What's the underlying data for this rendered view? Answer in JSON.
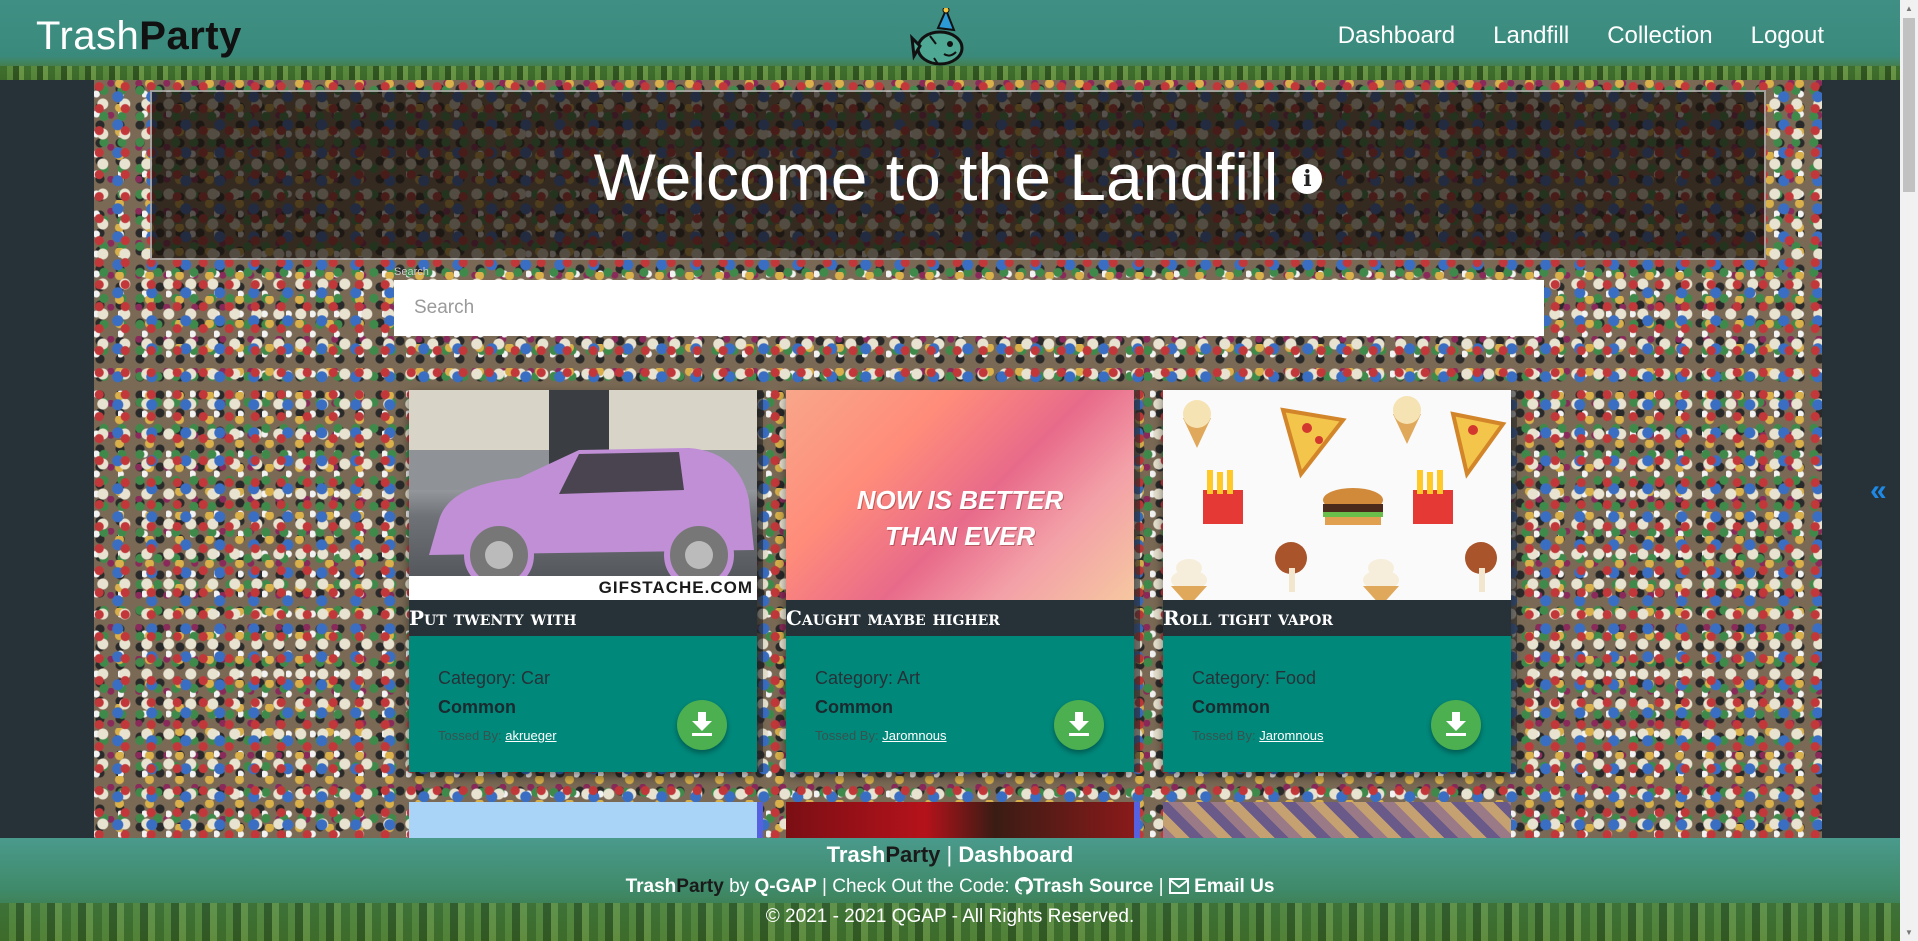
{
  "navbar": {
    "brand_part1": "Trash",
    "brand_part2": "Party",
    "links": [
      "Dashboard",
      "Landfill",
      "Collection",
      "Logout"
    ]
  },
  "banner": {
    "title": "Welcome to the Landfill"
  },
  "search": {
    "label": "Search",
    "placeholder": "Search"
  },
  "cards": [
    {
      "title": "Put twenty with",
      "category": "Category: Car",
      "rarity": "Common",
      "tossed_by_label": "Tossed By:",
      "tossed_by_user": "akrueger",
      "watermark": "GIFSTACHE.COM"
    },
    {
      "title": "Caught maybe higher",
      "category": "Category: Art",
      "rarity": "Common",
      "tossed_by_label": "Tossed By:",
      "tossed_by_user": "Jaromnous",
      "quote_line1": "NOW IS BETTER",
      "quote_line2": "THAN EVER"
    },
    {
      "title": "Roll tight vapor",
      "category": "Category: Food",
      "rarity": "Common",
      "tossed_by_label": "Tossed By:",
      "tossed_by_user": "Jaromnous"
    }
  ],
  "footer": {
    "line1_brand1": "Trash",
    "line1_brand2": "Party",
    "line1_sep": "|",
    "line1_link": "Dashboard",
    "line2_brand1": "Trash",
    "line2_brand2": "Party",
    "line2_by": "by",
    "line2_team": "Q-GAP",
    "line2_text": "| Check Out the Code:",
    "line2_source": "Trash Source",
    "line2_sep": "|",
    "line2_email": "Email Us",
    "copyright": "© 2021 - 2021 QGAP - All Rights Reserved."
  },
  "colors": {
    "navbar": "#3f8f85",
    "card_body": "#00897b",
    "card_title_bg": "#263238",
    "download_button": "#4caf50",
    "page_bg": "#263238"
  },
  "icons": [
    "party-fish-logo",
    "info-icon",
    "download-icon",
    "github-icon",
    "envelope-icon",
    "double-chevron-left-icon"
  ]
}
